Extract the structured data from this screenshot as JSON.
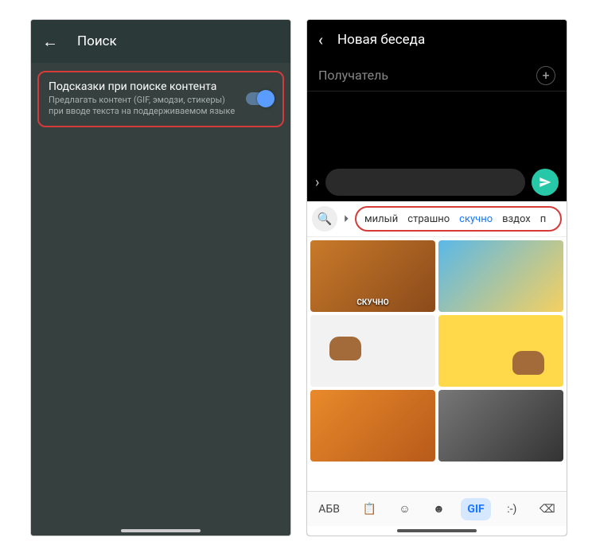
{
  "left": {
    "header_title": "Поиск",
    "setting_title": "Подсказки при поиске контента",
    "setting_desc": "Предлагать контент (GIF, эмодзи, стикеры) при вводе текста на поддерживаемом языке"
  },
  "right": {
    "header_title": "Новая беседа",
    "recipient_placeholder": "Получатель",
    "chips": [
      {
        "label": "милый",
        "active": false
      },
      {
        "label": "страшно",
        "active": false
      },
      {
        "label": "скучно",
        "active": true
      },
      {
        "label": "вздох",
        "active": false
      },
      {
        "label": "п",
        "active": false
      }
    ],
    "gif_captions": {
      "g1": "СКУЧНО"
    },
    "kb_bottom": {
      "abv": "АБВ",
      "gif": "GIF",
      "emoticon": ":-)"
    }
  }
}
